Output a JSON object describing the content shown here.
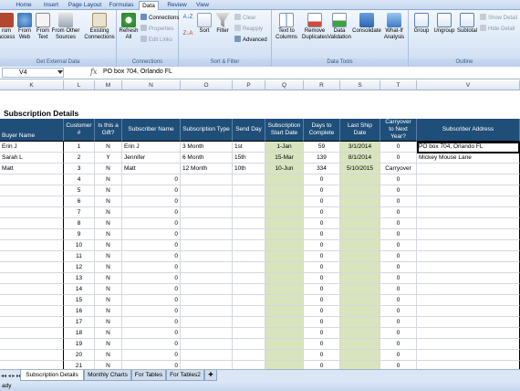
{
  "tabs": [
    "Home",
    "Insert",
    "Page Layout",
    "Formulas",
    "Data",
    "Review",
    "View"
  ],
  "active_tab": "Data",
  "ribbon": {
    "groups": {
      "external": "Get External Data",
      "connections": "Connections",
      "sortfilter": "Sort & Filter",
      "datatools": "Data Tools",
      "outline": "Outline"
    },
    "from_access": "rom\naccess",
    "from_web": "From\nWeb",
    "from_text": "From\nText",
    "from_other": "From Other\nSources",
    "existing": "Existing\nConnections",
    "refresh": "Refresh\nAll",
    "connections": "Connections",
    "properties": "Properties",
    "edit_links": "Edit Links",
    "sort": "Sort",
    "filter": "Filter",
    "clear": "Clear",
    "reapply": "Reapply",
    "advanced": "Advanced",
    "text_to_columns": "Text to\nColumns",
    "remove_duplicates": "Remove\nDuplicates",
    "data_validation": "Data\nValidation",
    "consolidate": "Consolidate",
    "what_if": "What-If\nAnalysis",
    "group": "Group",
    "ungroup": "Ungroup",
    "subtotal": "Subtotal",
    "show_detail": "Show Detail",
    "hide_detail": "Hide Detail"
  },
  "formula_bar": {
    "name_box": "V4",
    "fx": "fx",
    "content": "PO box 704, Orlando FL"
  },
  "columns": [
    "K",
    "L",
    "M",
    "N",
    "O",
    "P",
    "Q",
    "R",
    "S",
    "T",
    "U",
    "V"
  ],
  "sheet_title": "Subscription Details",
  "headers": [
    "Buyer Name",
    "Customer #",
    "Is this a Gift?",
    "Subscriber Name",
    "Subscription Type",
    "Send Day",
    "Subscription Start Date",
    "Days to Complete",
    "Last Ship Date",
    "Carryover to Next Year?",
    "Subscriber Address"
  ],
  "rows": [
    {
      "buyer": "Erin J",
      "num": "1",
      "gift": "N",
      "sub": "Erin J",
      "type": "3 Month",
      "day": "1st",
      "start": "1-Jan",
      "days": "59",
      "last": "3/1/2014",
      "carry": "0",
      "addr": "PO box 704, Orlando FL"
    },
    {
      "buyer": "Sarah L",
      "num": "2",
      "gift": "Y",
      "sub": "Jennifer",
      "type": "6 Month",
      "day": "15th",
      "start": "15-Mar",
      "days": "139",
      "last": "8/1/2014",
      "carry": "0",
      "addr": "Mickey Mouse Lane"
    },
    {
      "buyer": "Matt",
      "num": "3",
      "gift": "N",
      "sub": "Matt",
      "type": "12 Month",
      "day": "10th",
      "start": "10-Jun",
      "days": "334",
      "last": "5/10/2015",
      "carry": "Carryover",
      "addr": ""
    },
    {
      "buyer": "",
      "num": "4",
      "gift": "N",
      "sub": "0",
      "type": "",
      "day": "",
      "start": "",
      "days": "0",
      "last": "",
      "carry": "0",
      "addr": ""
    },
    {
      "buyer": "",
      "num": "5",
      "gift": "N",
      "sub": "0",
      "type": "",
      "day": "",
      "start": "",
      "days": "0",
      "last": "",
      "carry": "0",
      "addr": ""
    },
    {
      "buyer": "",
      "num": "6",
      "gift": "N",
      "sub": "0",
      "type": "",
      "day": "",
      "start": "",
      "days": "0",
      "last": "",
      "carry": "0",
      "addr": ""
    },
    {
      "buyer": "",
      "num": "7",
      "gift": "N",
      "sub": "0",
      "type": "",
      "day": "",
      "start": "",
      "days": "0",
      "last": "",
      "carry": "0",
      "addr": ""
    },
    {
      "buyer": "",
      "num": "8",
      "gift": "N",
      "sub": "0",
      "type": "",
      "day": "",
      "start": "",
      "days": "0",
      "last": "",
      "carry": "0",
      "addr": ""
    },
    {
      "buyer": "",
      "num": "9",
      "gift": "N",
      "sub": "0",
      "type": "",
      "day": "",
      "start": "",
      "days": "0",
      "last": "",
      "carry": "0",
      "addr": ""
    },
    {
      "buyer": "",
      "num": "10",
      "gift": "N",
      "sub": "0",
      "type": "",
      "day": "",
      "start": "",
      "days": "0",
      "last": "",
      "carry": "0",
      "addr": ""
    },
    {
      "buyer": "",
      "num": "11",
      "gift": "N",
      "sub": "0",
      "type": "",
      "day": "",
      "start": "",
      "days": "0",
      "last": "",
      "carry": "0",
      "addr": ""
    },
    {
      "buyer": "",
      "num": "12",
      "gift": "N",
      "sub": "0",
      "type": "",
      "day": "",
      "start": "",
      "days": "0",
      "last": "",
      "carry": "0",
      "addr": ""
    },
    {
      "buyer": "",
      "num": "13",
      "gift": "N",
      "sub": "0",
      "type": "",
      "day": "",
      "start": "",
      "days": "0",
      "last": "",
      "carry": "0",
      "addr": ""
    },
    {
      "buyer": "",
      "num": "14",
      "gift": "N",
      "sub": "0",
      "type": "",
      "day": "",
      "start": "",
      "days": "0",
      "last": "",
      "carry": "0",
      "addr": ""
    },
    {
      "buyer": "",
      "num": "15",
      "gift": "N",
      "sub": "0",
      "type": "",
      "day": "",
      "start": "",
      "days": "0",
      "last": "",
      "carry": "0",
      "addr": ""
    },
    {
      "buyer": "",
      "num": "16",
      "gift": "N",
      "sub": "0",
      "type": "",
      "day": "",
      "start": "",
      "days": "0",
      "last": "",
      "carry": "0",
      "addr": ""
    },
    {
      "buyer": "",
      "num": "17",
      "gift": "N",
      "sub": "0",
      "type": "",
      "day": "",
      "start": "",
      "days": "0",
      "last": "",
      "carry": "0",
      "addr": ""
    },
    {
      "buyer": "",
      "num": "18",
      "gift": "N",
      "sub": "0",
      "type": "",
      "day": "",
      "start": "",
      "days": "0",
      "last": "",
      "carry": "0",
      "addr": ""
    },
    {
      "buyer": "",
      "num": "19",
      "gift": "N",
      "sub": "0",
      "type": "",
      "day": "",
      "start": "",
      "days": "0",
      "last": "",
      "carry": "0",
      "addr": ""
    },
    {
      "buyer": "",
      "num": "20",
      "gift": "N",
      "sub": "0",
      "type": "",
      "day": "",
      "start": "",
      "days": "0",
      "last": "",
      "carry": "0",
      "addr": ""
    },
    {
      "buyer": "",
      "num": "21",
      "gift": "N",
      "sub": "0",
      "type": "",
      "day": "",
      "start": "",
      "days": "0",
      "last": "",
      "carry": "0",
      "addr": ""
    }
  ],
  "sheet_tabs": [
    "Subscription Details",
    "Monthly Charts",
    "For Tables",
    "For Tables2"
  ],
  "nav_arrows": "◂◂ ◂ ▸ ▸▸",
  "status": "ady",
  "colors": {
    "header_bg": "#1f4e79",
    "green_fill": "#d8e4bc",
    "ribbon_bg": "#dce8f7"
  }
}
